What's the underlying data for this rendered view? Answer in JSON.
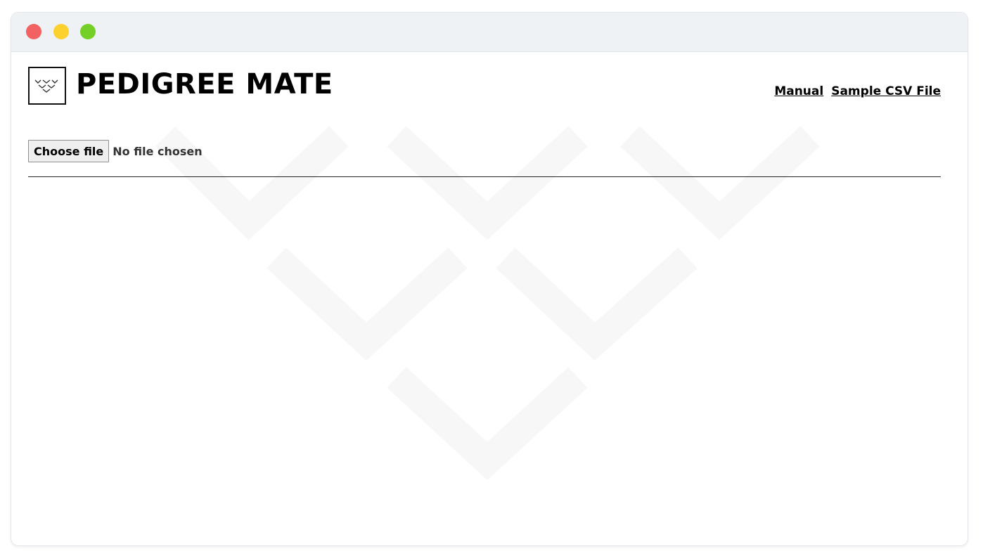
{
  "window": {
    "controls": [
      "close",
      "minimize",
      "maximize"
    ]
  },
  "header": {
    "logo_icon": "pedigree-chevrons-logo",
    "title": "PEDIGREE MATE",
    "links": [
      {
        "label": "Manual"
      },
      {
        "label": "Sample CSV File"
      }
    ]
  },
  "upload": {
    "button_label": "Choose file",
    "status_text": "No file chosen"
  },
  "colors": {
    "titlebar": "#eff2f5",
    "close": "#f26262",
    "minimize": "#fcd02d",
    "maximize": "#74cf27",
    "watermark": "#f7f7f7"
  }
}
